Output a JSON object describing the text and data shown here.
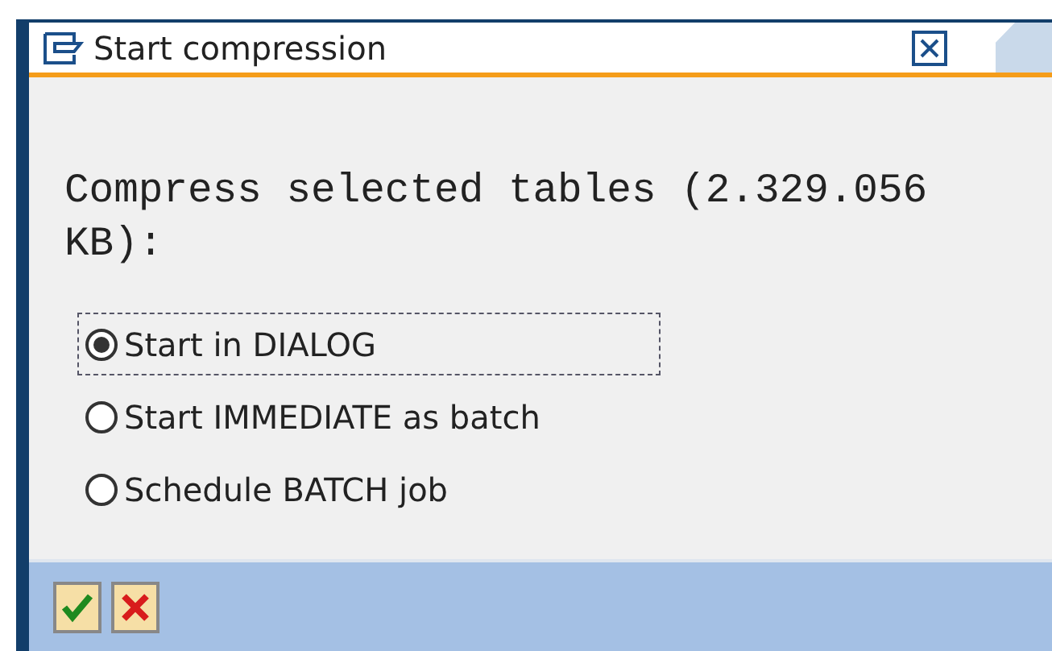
{
  "window": {
    "title": "Start compression"
  },
  "message": "Compress selected tables (2.329.056 KB):",
  "options": [
    {
      "label": "Start in DIALOG",
      "selected": true,
      "focused": true
    },
    {
      "label": "Start IMMEDIATE as batch",
      "selected": false,
      "focused": false
    },
    {
      "label": "Schedule BATCH job",
      "selected": false,
      "focused": false
    }
  ],
  "buttons": [
    {
      "kind": "confirm"
    },
    {
      "kind": "cancel"
    }
  ]
}
